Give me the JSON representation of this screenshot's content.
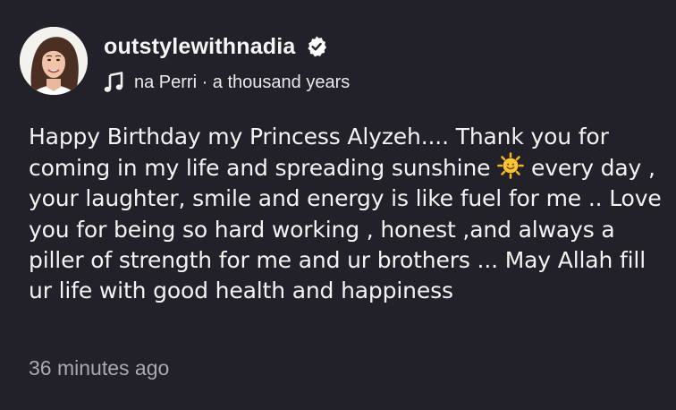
{
  "post": {
    "username": "outstylewithnadia",
    "verified_icon": "verified-badge-icon",
    "music": {
      "icon": "music-note-icon",
      "text": "na Perri · a thousand years"
    },
    "caption_part1": "Happy Birthday my Princess Alyzeh.... Thank you for coming in my life and spreading sunshine ",
    "caption_emoji_icon": "sun-emoji-icon",
    "caption_part2": " every day , your laughter, smile and energy is like fuel for me .. Love you for being so hard working , honest ,and always a piller of strength for me and ur brothers ... May Allah fill ur life with good health and happiness",
    "timestamp": "36 minutes ago"
  },
  "colors": {
    "background": "#222129",
    "text": "#f3f3f3",
    "muted": "#a9a9ae",
    "verified_fill": "#ffffff",
    "sun": "#f7b21f"
  }
}
